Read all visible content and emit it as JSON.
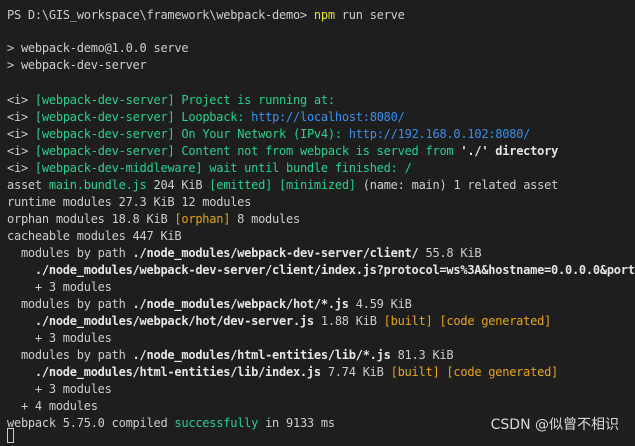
{
  "terminal": {
    "prompt": {
      "path": "PS D:\\GIS_workspace\\framework\\webpack-demo> ",
      "command": "npm",
      "args": " run serve"
    },
    "script_lines": [
      "> webpack-demo@1.0.0 serve",
      "> webpack-dev-server"
    ],
    "info": {
      "tag": "<i>",
      "l1_src": "[webpack-dev-server]",
      "l1_text": " Project is running at:",
      "l2_src": "[webpack-dev-server]",
      "l2_text": " Loopback: ",
      "l2_url": "http://localhost:8080/",
      "l3_src": "[webpack-dev-server]",
      "l3_text": " On Your Network (IPv4): ",
      "l3_url": "http://192.168.0.102:8080/",
      "l4_src": "[webpack-dev-server]",
      "l4_text": " Content not from webpack is served from ",
      "l4_dir": "'./'",
      "l4_tail": " directory",
      "l5_src": "[webpack-dev-middleware]",
      "l5_text": " wait until bundle finished: /"
    },
    "build": {
      "asset_label": "asset ",
      "asset_name": "main.bundle.js",
      "asset_size": " 204 KiB ",
      "asset_emitted": "[emitted]",
      "asset_minimized": "[minimized]",
      "asset_tail": " (name: main) 1 related asset",
      "runtime": "runtime modules 27.3 KiB 12 modules",
      "orphan_label": "orphan modules 18.8 KiB ",
      "orphan_tag": "[orphan]",
      "orphan_tail": " 8 modules",
      "cacheable": "cacheable modules 447 KiB",
      "g1_label": "  modules by path ",
      "g1_path": "./node_modules/webpack-dev-server/client/",
      "g1_size": " 55.8 KiB",
      "g1_file": "    ./node_modules/webpack-dev-server/client/index.js?protocol=ws%3A&hostname=0.0.0.0&port",
      "g1_more": "    + 3 modules",
      "g2_label": "  modules by path ",
      "g2_path": "./node_modules/webpack/hot/*.js",
      "g2_size": " 4.59 KiB",
      "g2_file": "    ./node_modules/webpack/hot/dev-server.js",
      "g2_file_size": " 1.88 KiB ",
      "g2_built": "[built]",
      "g2_code": "[code generated]",
      "g2_more": "    + 3 modules",
      "g3_label": "  modules by path ",
      "g3_path": "./node_modules/html-entities/lib/*.js",
      "g3_size": " 81.3 KiB",
      "g3_file": "    ./node_modules/html-entities/lib/index.js",
      "g3_file_size": " 7.74 KiB ",
      "g3_built": "[built]",
      "g3_code": "[code generated]",
      "g3_more": "    + 3 modules",
      "more4": "  + 4 modules",
      "compiled_prefix": "webpack 5.75.0 compiled ",
      "compiled_status": "successfully",
      "compiled_tail": " in 9133 ms"
    },
    "watermark": "CSDN @似曾不相识"
  },
  "colors": {
    "background": "#1e1e1e",
    "text": "#cccccc",
    "yellow": "#e5e510",
    "green": "#23d18b",
    "blue": "#3b8eea",
    "orange": "#e5a50a"
  }
}
